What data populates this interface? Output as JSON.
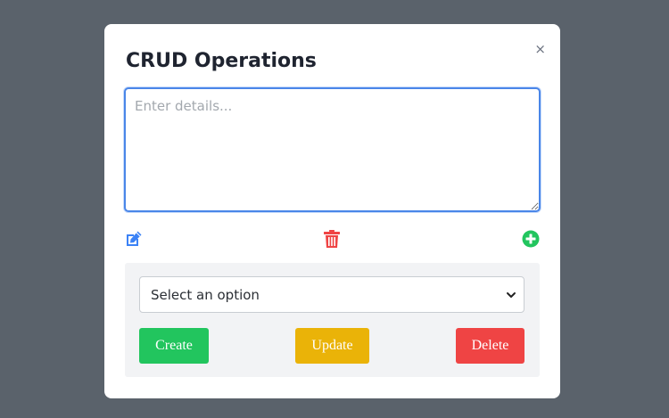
{
  "modal": {
    "title": "CRUD Operations",
    "close_label": "×"
  },
  "details": {
    "placeholder": "Enter details...",
    "value": ""
  },
  "icons": {
    "edit": "edit-icon",
    "trash": "trash-icon",
    "add": "plus-circle-icon"
  },
  "colors": {
    "overlay": "#5a626b",
    "accent_blue": "#3b82f6",
    "create": "#22c55e",
    "update": "#eab308",
    "delete": "#ef4444"
  },
  "panel": {
    "select_value": "Select an option",
    "create_label": "Create",
    "update_label": "Update",
    "delete_label": "Delete"
  }
}
